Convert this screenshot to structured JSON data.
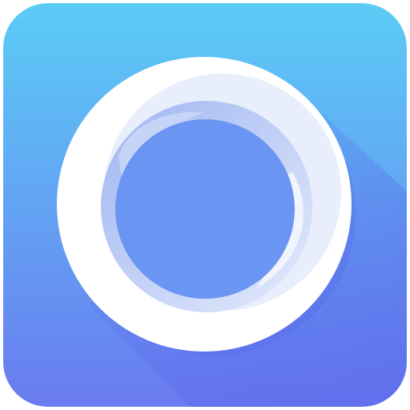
{
  "icon": {
    "name": "ring-logo-icon",
    "colors": {
      "gradient_top": "#5BCCF6",
      "gradient_bottom": "#6A7BF0",
      "shadow": "#5660E8",
      "ring_white": "#FFFFFF",
      "ring_inner_light": "#D6E2FA",
      "ring_inner_shade": "#9FB6F2",
      "center": "#6B95F2"
    }
  }
}
